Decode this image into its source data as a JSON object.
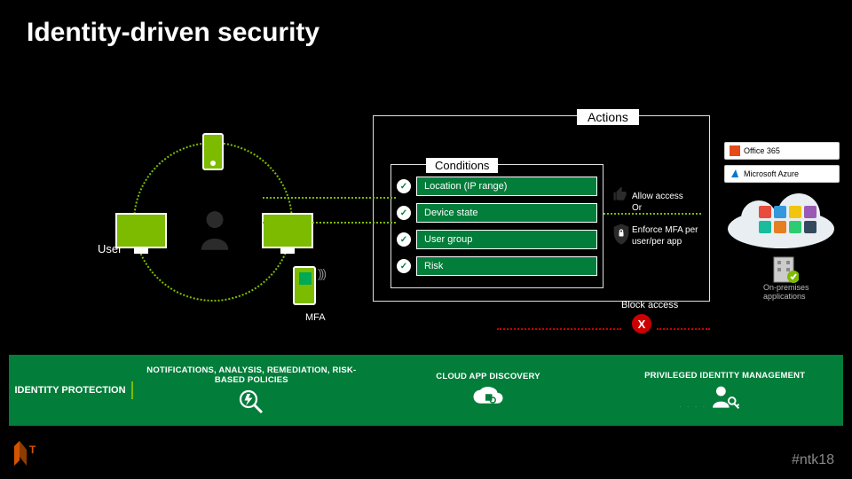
{
  "title": "Identity-driven security",
  "actions_label": "Actions",
  "conditions_label": "Conditions",
  "conditions": [
    "Location (IP range)",
    "Device state",
    "User group",
    "Risk"
  ],
  "user_label": "User",
  "mfa_label": "MFA",
  "allow": {
    "line1": "Allow access",
    "line2": "Or",
    "line3": "Enforce MFA per",
    "line4": "user/per app"
  },
  "block_label": "Block access",
  "block_x": "X",
  "cloud_cards": {
    "office": "Office 365",
    "azure": "Microsoft Azure"
  },
  "onprem_label": "On-premises applications",
  "band": {
    "identity_protection": "IDENTITY PROTECTION",
    "narp": "NOTIFICATIONS, ANALYSIS, REMEDIATION, RISK-BASED POLICIES",
    "cad": "CLOUD APP DISCOVERY",
    "pim": "PRIVILEGED IDENTITY MANAGEMENT"
  },
  "hashtag": "#ntk18",
  "app_colors": [
    "#e74c3c",
    "#3498db",
    "#f1c40f",
    "#9b59b6",
    "#1abc9c",
    "#e67e22",
    "#2ecc71",
    "#34495e"
  ]
}
